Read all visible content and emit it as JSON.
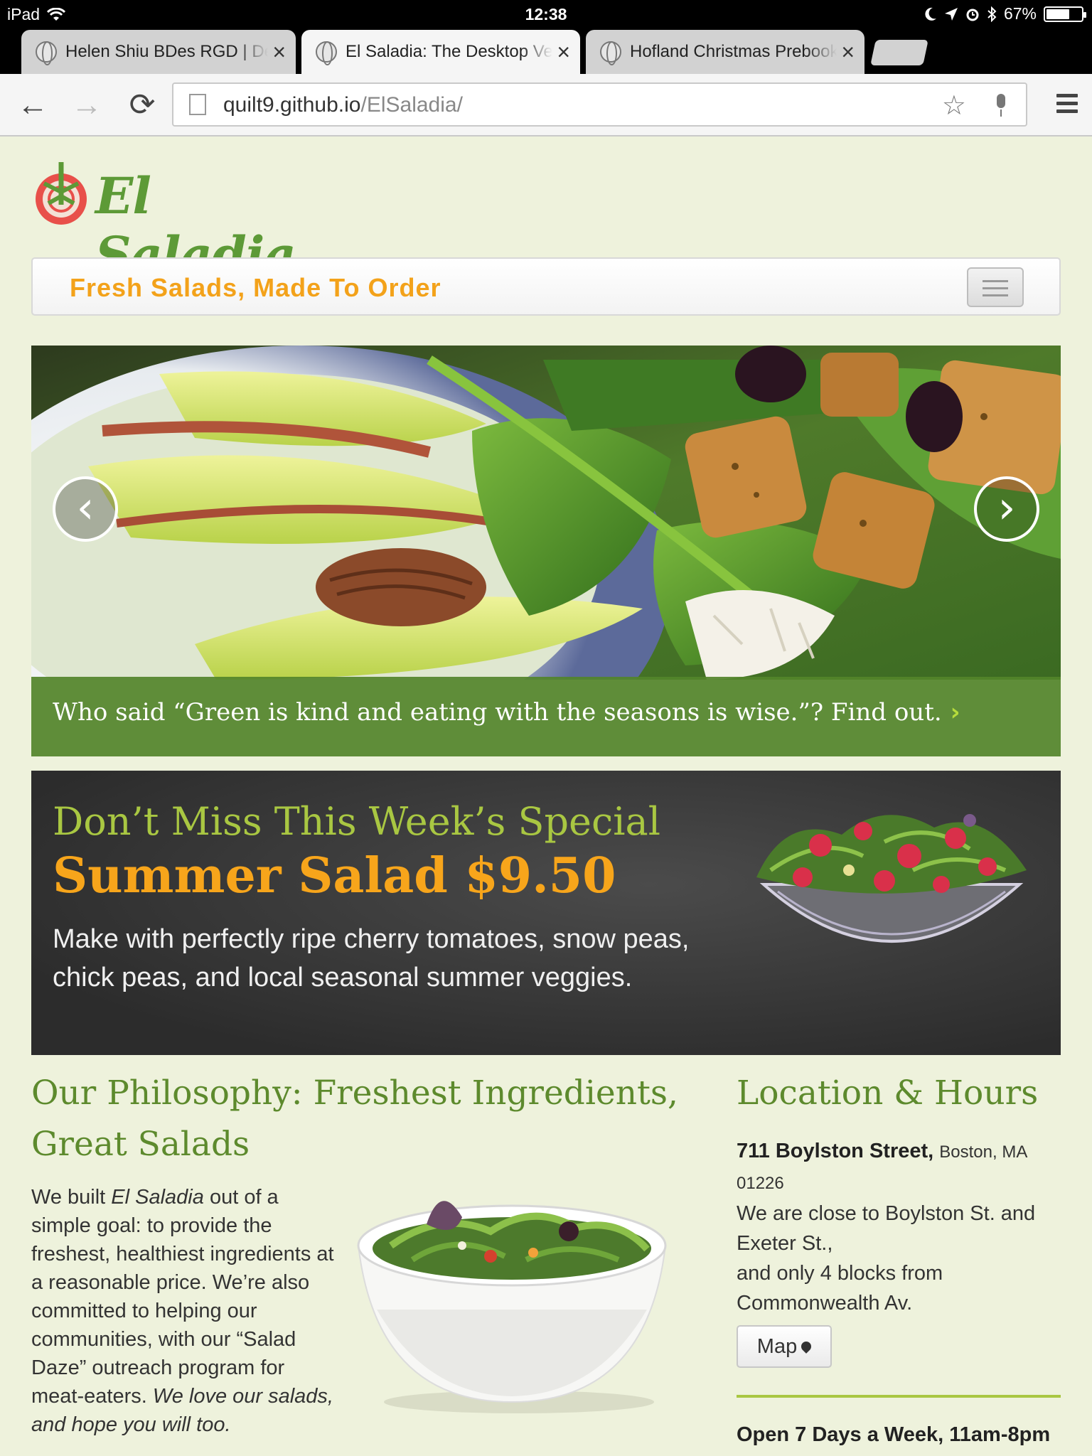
{
  "status_bar": {
    "device": "iPad",
    "time": "12:38",
    "battery_percent": "67%",
    "battery_level": 0.67,
    "icons": [
      "wifi-icon",
      "moon-icon",
      "location-arrow-icon",
      "alarm-icon",
      "bluetooth-icon",
      "battery-icon"
    ]
  },
  "tabs": [
    {
      "title": "Helen Shiu BDes RGD | Des",
      "active": false
    },
    {
      "title": "El Saladia: The Desktop Vers",
      "active": true
    },
    {
      "title": "Hofland Christmas Prebook",
      "active": false
    }
  ],
  "toolbar": {
    "url_host": "quilt9.github.io",
    "url_path": "/ElSaladia/",
    "back_icon": "←",
    "forward_icon": "→",
    "reload_icon": "⟳",
    "star_icon": "☆"
  },
  "site": {
    "logo_text": "El Saladia",
    "tagline": "Fresh Salads, Made To Order"
  },
  "hero": {
    "caption": "Who said “Green is kind and eating with the seasons is wise.”? Find out.",
    "caption_chevron": "›",
    "prev_icon": "‹",
    "next_icon": "›"
  },
  "special": {
    "heading": "Don’t Miss This Week’s Special",
    "title": "Summer Salad $9.50",
    "description": "Make with perfectly ripe cherry tomatoes, snow peas, chick peas, and local seasonal summer veggies."
  },
  "philosophy": {
    "heading": "Our Philosophy: Freshest Ingredients, Great Salads",
    "text_1": "We built ",
    "text_em_1": "El Saladia",
    "text_2": " out of a simple goal: to provide the freshest, healthiest ingredients at a reasonable price. We’re also committed to helping our communities, with our “Salad Daze” outreach program for meat-eaters. ",
    "text_em_2": "We love our salads, and hope you will too."
  },
  "location": {
    "heading": "Location & Hours",
    "street": "711 Boylston Street,",
    "city": "Boston, MA 01226",
    "directions_1": "We are close to Boylston St. and Exeter St.,",
    "directions_2": "and only 4 blocks from Commonwealth Av.",
    "map_label": "Map",
    "hours": "Open 7 Days a Week, 11am-8pm"
  }
}
